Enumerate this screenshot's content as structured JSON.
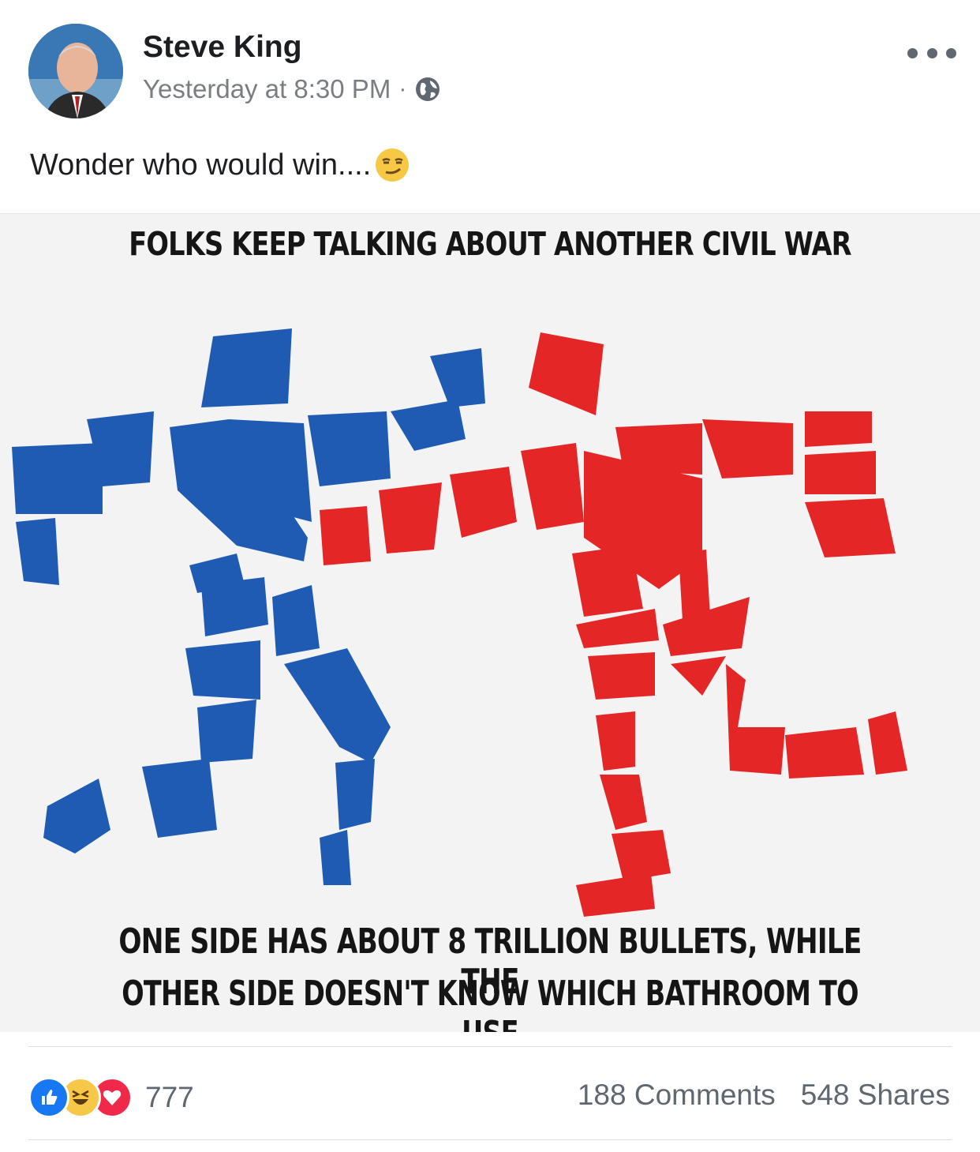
{
  "post": {
    "author": "Steve King",
    "timestamp": "Yesterday at 8:30 PM",
    "separator": "·",
    "privacy_icon": "globe-icon",
    "text": "Wonder who would win....",
    "text_emoji": "smirking-face-emoji"
  },
  "meme": {
    "headline_top": "FOLKS KEEP TALKING ABOUT ANOTHER CIVIL WAR",
    "headline_bottom_line1": "ONE SIDE HAS ABOUT 8 TRILLION BULLETS, WHILE THE",
    "headline_bottom_line2": "OTHER SIDE DOESN'T KNOW WHICH BATHROOM TO USE",
    "colors": {
      "blue_figure": "#1f5bb3",
      "red_figure": "#e52626"
    }
  },
  "footer": {
    "reaction_icons": [
      "like-icon",
      "haha-icon",
      "love-icon"
    ],
    "reaction_count": "777",
    "comments": "188 Comments",
    "shares": "548 Shares"
  }
}
